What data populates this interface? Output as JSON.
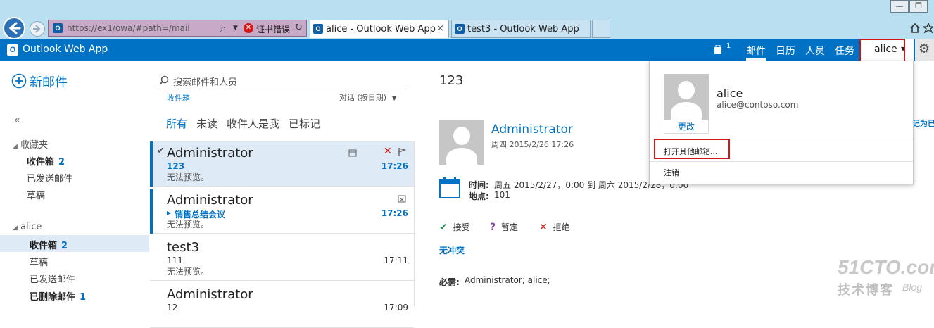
{
  "browser": {
    "address_url": "https://ex1/owa/#path=/mail",
    "address_host": "ex1",
    "search_glyph": "⌕",
    "cert_error": "证书错误",
    "tabs": [
      {
        "label": "alice - Outlook Web App",
        "close": "×"
      },
      {
        "label": "test3 - Outlook Web App"
      }
    ],
    "window_buttons": [
      "—",
      "❐"
    ]
  },
  "header": {
    "app_name": "Outlook Web App",
    "badge_count": "1",
    "nav": [
      "邮件",
      "日历",
      "人员",
      "任务"
    ],
    "user": "alice",
    "user_caret": "▾",
    "gear": "⚙"
  },
  "sidebar": {
    "new_mail": "新邮件",
    "collapse": "«",
    "favorites_header": "收藏夹",
    "favorites": [
      {
        "label": "收件箱",
        "count": "2"
      },
      {
        "label": "已发送邮件"
      },
      {
        "label": "草稿"
      }
    ],
    "account_header": "alice",
    "account_folders": [
      {
        "label": "收件箱",
        "count": "2"
      },
      {
        "label": "草稿"
      },
      {
        "label": "已发送邮件"
      },
      {
        "label": "已删除邮件",
        "count": "1"
      }
    ]
  },
  "list": {
    "search_placeholder": "搜索邮件和人员",
    "folder_label": "收件箱",
    "sort_label": "对话 (按日期)",
    "filters": [
      "所有",
      "未读",
      "收件人是我",
      "已标记"
    ],
    "messages": [
      {
        "from": "Administrator",
        "subject": "123",
        "preview": "无法预览。",
        "time": "17:26"
      },
      {
        "from": "Administrator",
        "subject": "销售总结会议",
        "preview": "无法预览。",
        "time": "17:26"
      },
      {
        "from": "test3",
        "subject": "111",
        "preview": "无法预览。",
        "time": "17:11"
      },
      {
        "from": "Administrator",
        "subject": "12",
        "preview": "",
        "time": "17:09"
      }
    ]
  },
  "reading": {
    "subject": "123",
    "sender": "Administrator",
    "sent": "周四 2015/2/26 17:26",
    "time_label": "时间:",
    "time_value": "周五 2015/2/27，0:00 到 周六 2015/2/28，0:00",
    "location_label": "地点:",
    "location_value": "101",
    "accept": "接受",
    "tentative": "暂定",
    "decline": "拒绝",
    "no_conflict": "无冲突",
    "required_label": "必需:",
    "required_value": "Administrator;  alice;",
    "side_link": "记为已"
  },
  "popup": {
    "name": "alice",
    "email": "alice@contoso.com",
    "change": "更改",
    "open_other": "打开其他邮箱...",
    "sign_out": "注销"
  },
  "watermark": {
    "site": "51CTO.com",
    "tagline": "技术博客",
    "blog": "Blog"
  },
  "colors": {
    "brand": "#0072c6",
    "accent_red": "#d21616",
    "selected_row": "#deeaf6"
  }
}
